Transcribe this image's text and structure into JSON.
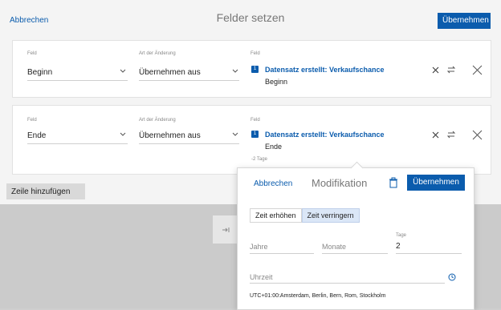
{
  "header": {
    "cancel_label": "Abbrechen",
    "title": "Felder setzen",
    "apply_label": "Übernehmen"
  },
  "rows": [
    {
      "feld_label": "Feld",
      "feld_value": "Beginn",
      "art_label": "Art der Änderung",
      "art_value": "Übernehmen aus",
      "source_label": "Feld",
      "badge": "1",
      "source_title": "Datensatz erstellt: Verkaufschance",
      "source_field": "Beginn"
    },
    {
      "feld_label": "Feld",
      "feld_value": "Ende",
      "art_label": "Art der Änderung",
      "art_value": "Übernehmen aus",
      "source_label": "Feld",
      "badge": "1",
      "source_title": "Datensatz erstellt: Verkaufschance",
      "source_field": "Ende",
      "modifier_note": "-2 Tage"
    }
  ],
  "add_row_label": "Zeile hinzufügen",
  "popover": {
    "cancel_label": "Abbrechen",
    "title": "Modifikation",
    "apply_label": "Übernehmen",
    "toggle": {
      "increase_label": "Zeit erhöhen",
      "decrease_label": "Zeit verringern",
      "selected": "Zeit verringern"
    },
    "fields": {
      "jahre_placeholder": "Jahre",
      "monate_placeholder": "Monate",
      "tage_label": "Tage",
      "tage_value": "2",
      "uhrzeit_placeholder": "Uhrzeit"
    },
    "timezone": "UTC+01:00:Amsterdam, Berlin, Bern, Rom, Stockholm"
  },
  "colors": {
    "accent": "#0b5cad",
    "panel_bg": "#f4f4f4",
    "overlay_bg": "#cbcbcb"
  }
}
